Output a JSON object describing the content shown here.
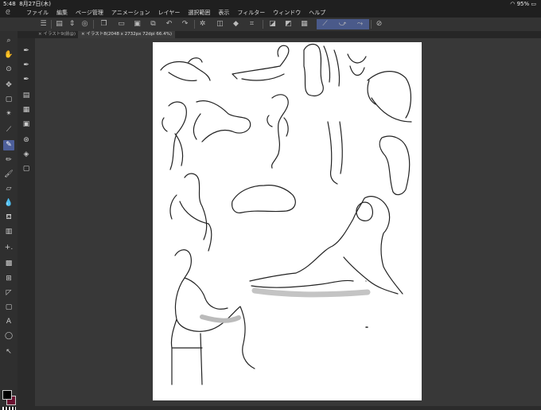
{
  "status": {
    "time": "5:48",
    "date": "8月27日(木)",
    "battery": "95%"
  },
  "menu": [
    "ファイル",
    "編集",
    "ページ管理",
    "アニメーション",
    "レイヤー",
    "選択範囲",
    "表示",
    "フィルター",
    "ウィンドウ",
    "ヘルプ"
  ],
  "tabs": [
    {
      "label": "イラスト9(前@)",
      "active": false
    },
    {
      "label": "イラスト8(2048 x 2732px 72dpi 66.4%)",
      "active": true
    }
  ]
}
